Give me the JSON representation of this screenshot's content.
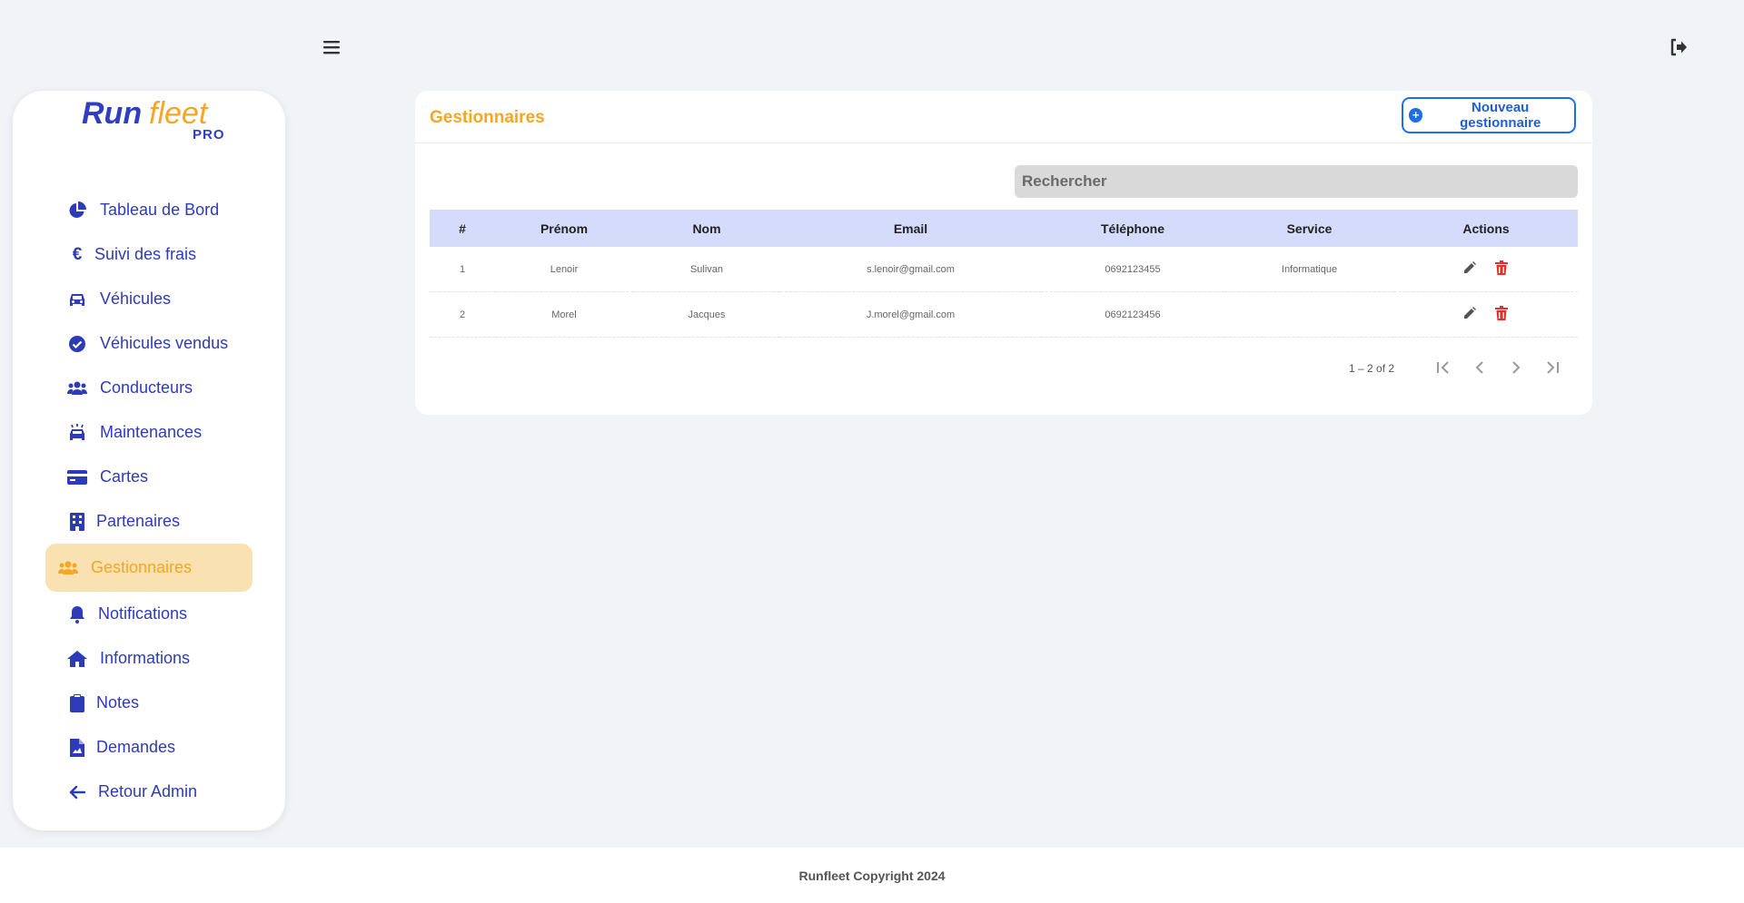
{
  "logo": {
    "part1": "Run",
    "part2": "fleet",
    "part3": "PRO"
  },
  "sidebar": {
    "items": [
      {
        "label": "Tableau de Bord",
        "icon": "pie-chart-icon"
      },
      {
        "label": "Suivi des frais",
        "icon": "euro-icon"
      },
      {
        "label": "Véhicules",
        "icon": "car-icon"
      },
      {
        "label": "Véhicules vendus",
        "icon": "check-circle-icon"
      },
      {
        "label": "Conducteurs",
        "icon": "users-icon"
      },
      {
        "label": "Maintenances",
        "icon": "car-wash-icon"
      },
      {
        "label": "Cartes",
        "icon": "credit-card-icon"
      },
      {
        "label": "Partenaires",
        "icon": "building-icon"
      },
      {
        "label": "Gestionnaires",
        "icon": "users-icon",
        "active": true
      },
      {
        "label": "Notifications",
        "icon": "bell-icon"
      },
      {
        "label": "Informations",
        "icon": "home-icon"
      },
      {
        "label": "Notes",
        "icon": "clipboard-icon"
      },
      {
        "label": "Demandes",
        "icon": "file-icon"
      },
      {
        "label": "Retour Admin",
        "icon": "arrow-left-icon"
      }
    ]
  },
  "page": {
    "title": "Gestionnaires",
    "new_button_label": "Nouveau gestionnaire",
    "search_placeholder": "Rechercher"
  },
  "table": {
    "headers": [
      "#",
      "Prénom",
      "Nom",
      "Email",
      "Téléphone",
      "Service",
      "Actions"
    ],
    "rows": [
      {
        "id": "1",
        "prenom": "Lenoir",
        "nom": "Sulivan",
        "email": "s.lenoir@gmail.com",
        "telephone": "0692123455",
        "service": "Informatique"
      },
      {
        "id": "2",
        "prenom": "Morel",
        "nom": "Jacques",
        "email": "J.morel@gmail.com",
        "telephone": "0692123456",
        "service": ""
      }
    ]
  },
  "pagination": {
    "range_text": "1 – 2 of 2"
  },
  "footer": {
    "text": "Runfleet Copyright 2024"
  },
  "colors": {
    "primary": "#2d3bb8",
    "accent": "#f5a623",
    "active_bg": "#f9e1b1",
    "header_bg": "#d5dcfb",
    "delete": "#e03131"
  }
}
